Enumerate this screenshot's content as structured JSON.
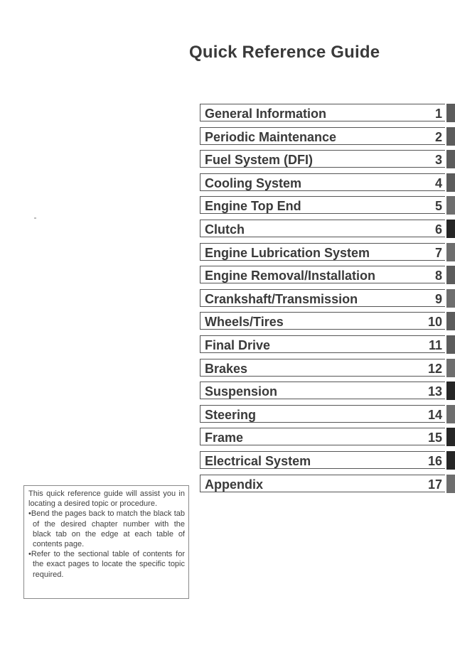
{
  "page": {
    "title": "Quick Reference Guide"
  },
  "toc": {
    "entries": [
      {
        "label": "General Information",
        "number": "1",
        "tab": "mid"
      },
      {
        "label": "Periodic Maintenance",
        "number": "2",
        "tab": "mid"
      },
      {
        "label": "Fuel System (DFI)",
        "number": "3",
        "tab": "mid"
      },
      {
        "label": "Cooling System",
        "number": "4",
        "tab": "mid"
      },
      {
        "label": "Engine Top End",
        "number": "5",
        "tab": "light"
      },
      {
        "label": "Clutch",
        "number": "6",
        "tab": "dark"
      },
      {
        "label": "Engine Lubrication System",
        "number": "7",
        "tab": "light"
      },
      {
        "label": "Engine Removal/Installation",
        "number": "8",
        "tab": "mid"
      },
      {
        "label": "Crankshaft/Transmission",
        "number": "9",
        "tab": "light"
      },
      {
        "label": "Wheels/Tires",
        "number": "10",
        "tab": "mid"
      },
      {
        "label": "Final Drive",
        "number": "11",
        "tab": "mid"
      },
      {
        "label": "Brakes",
        "number": "12",
        "tab": "light"
      },
      {
        "label": "Suspension",
        "number": "13",
        "tab": "dark"
      },
      {
        "label": "Steering",
        "number": "14",
        "tab": "light"
      },
      {
        "label": "Frame",
        "number": "15",
        "tab": "dark"
      },
      {
        "label": "Electrical System",
        "number": "16",
        "tab": "dark"
      },
      {
        "label": "Appendix",
        "number": "17",
        "tab": "light"
      }
    ]
  },
  "note": {
    "intro": "This quick reference guide will assist you in locating a desired topic or procedure.",
    "bullets": [
      "•Bend the pages back to match the black tab of the desired chapter number with the black tab on the edge at each table of contents page.",
      "•Refer to the sectional table of contents for the exact pages to locate the specific topic required."
    ]
  }
}
